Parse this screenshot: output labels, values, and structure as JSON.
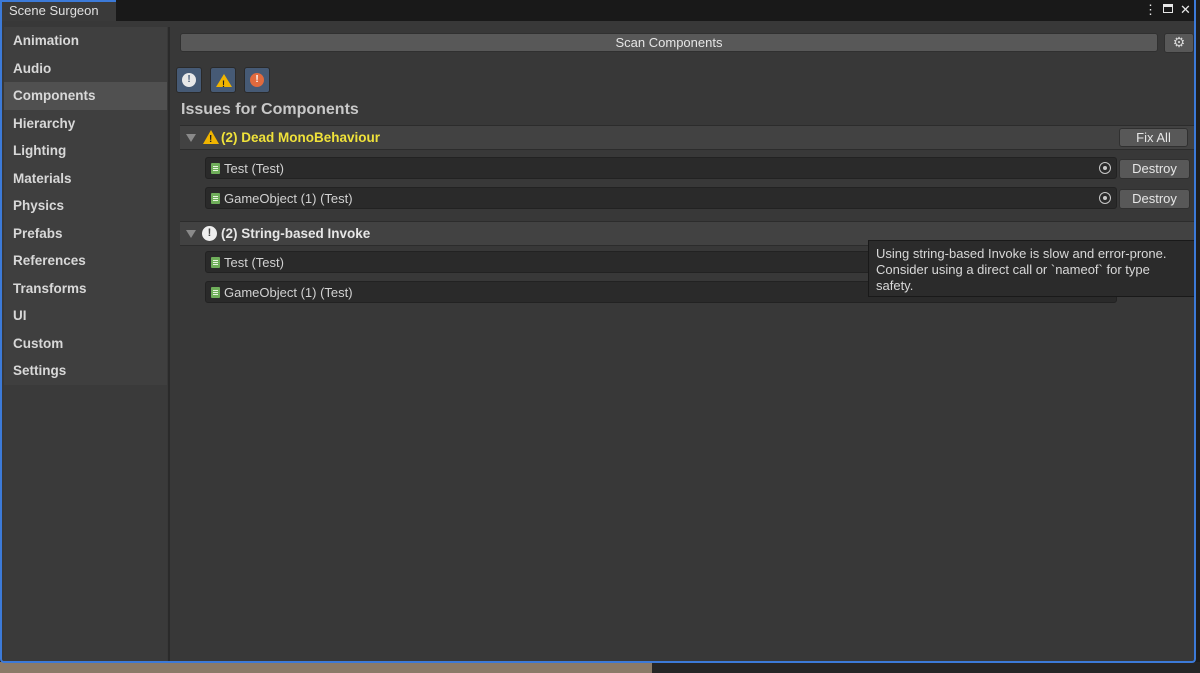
{
  "window": {
    "title": "Scene Surgeon",
    "icons": [
      "more-vert-icon",
      "maximize-icon",
      "close-icon"
    ]
  },
  "sidebar": {
    "items": [
      {
        "label": "Animation",
        "active": false
      },
      {
        "label": "Audio",
        "active": false
      },
      {
        "label": "Components",
        "active": true
      },
      {
        "label": "Hierarchy",
        "active": false
      },
      {
        "label": "Lighting",
        "active": false
      },
      {
        "label": "Materials",
        "active": false
      },
      {
        "label": "Physics",
        "active": false
      },
      {
        "label": "Prefabs",
        "active": false
      },
      {
        "label": "References",
        "active": false
      },
      {
        "label": "Transforms",
        "active": false
      },
      {
        "label": "UI",
        "active": false
      },
      {
        "label": "Custom",
        "active": false
      },
      {
        "label": "Settings",
        "active": false
      }
    ]
  },
  "toolbar": {
    "scan_label": "Scan Components",
    "settings_icon": "gear-icon",
    "filters": [
      {
        "name": "info-filter",
        "icon": "info-icon"
      },
      {
        "name": "warning-filter",
        "icon": "warning-icon"
      },
      {
        "name": "error-filter",
        "icon": "error-icon"
      }
    ]
  },
  "main": {
    "issues_title": "Issues for Components",
    "groups": [
      {
        "title": "(2) Dead MonoBehaviour",
        "severity": "warning",
        "fix_all_label": "Fix All",
        "items": [
          {
            "label": "Test (Test)",
            "action": "Destroy"
          },
          {
            "label": "GameObject (1) (Test)",
            "action": "Destroy"
          }
        ]
      },
      {
        "title": "(2) String-based Invoke",
        "severity": "info",
        "items": [
          {
            "label": "Test (Test)"
          },
          {
            "label": "GameObject (1) (Test)"
          }
        ]
      }
    ]
  },
  "tooltip": {
    "text": "Using string-based Invoke is slow and error-prone. Consider using a direct call or `nameof` for type safety."
  },
  "colors": {
    "accent": "#3c7ad8",
    "warning_text": "#f0e23a",
    "warning_icon": "#f0b400",
    "error_icon": "#e06a3e",
    "panel_bg": "#383838"
  }
}
